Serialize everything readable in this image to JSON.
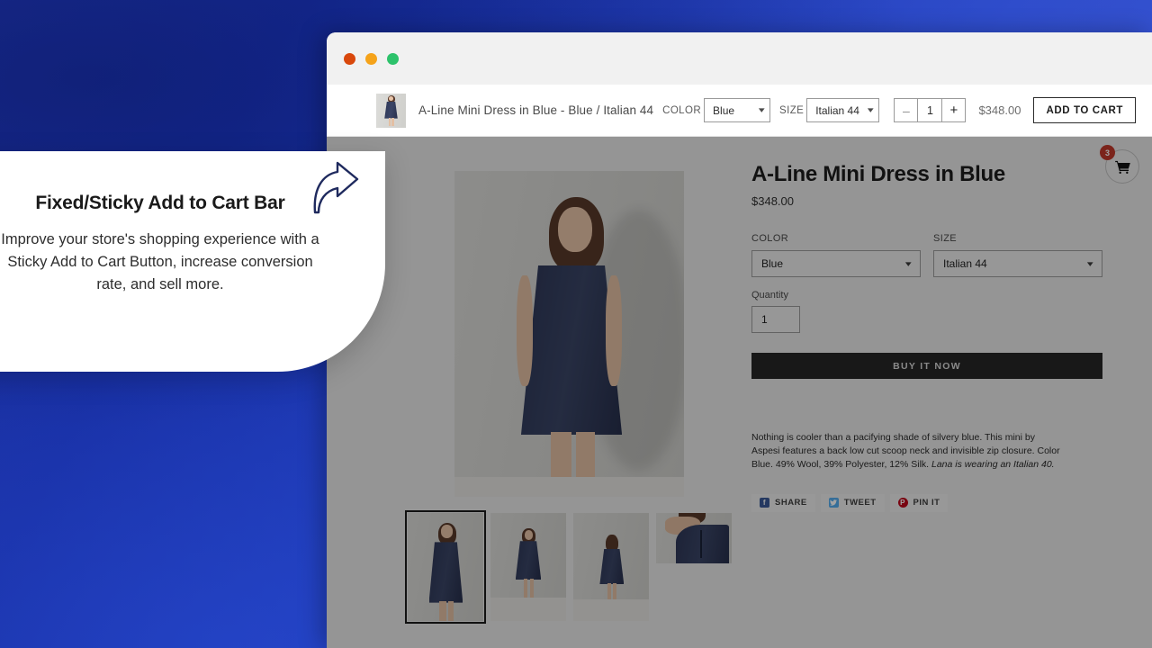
{
  "promo": {
    "title": "Fixed/Sticky Add to Cart Bar",
    "body": "Improve your store's shopping experience with a Sticky Add to Cart Button, increase conversion rate, and sell more.",
    "arrow_icon": "curved-arrow-up-right-icon",
    "arrow_color": "#1f2a5e"
  },
  "browser": {
    "traffic_lights": [
      {
        "name": "close",
        "color": "#d9480c"
      },
      {
        "name": "minimize",
        "color": "#f5a31a"
      },
      {
        "name": "maximize",
        "color": "#2dc26b"
      }
    ]
  },
  "sticky_bar": {
    "thumbnail_icon": "product-thumbnail",
    "product_title": "A-Line Mini Dress in Blue - Blue / Italian 44",
    "color_label": "COLOR",
    "color_value": "Blue",
    "size_label": "SIZE",
    "size_value": "Italian 44",
    "qty_minus": "–",
    "qty_value": "1",
    "qty_plus": "+",
    "price": "$348.00",
    "add_to_cart_label": "ADD TO CART",
    "chevron_icon": "chevron-down-icon"
  },
  "product": {
    "title": "A-Line Mini Dress in Blue",
    "price": "$348.00",
    "color_label": "COLOR",
    "color_value": "Blue",
    "size_label": "SIZE",
    "size_value": "Italian 44",
    "quantity_label": "Quantity",
    "quantity_value": "1",
    "buy_now_label": "BUY IT NOW",
    "description_part1": "Nothing is cooler than a pacifying shade of silvery blue. This mini by Aspesi features a back low cut scoop neck and invisible zip closure. Color Blue. 49% Wool, 39% Polyester, 12% Silk. ",
    "description_emphasis": "Lana is wearing an Italian 40.",
    "share": [
      {
        "icon": "facebook-icon",
        "label": "SHARE",
        "color": "#3b5998",
        "glyph": "f"
      },
      {
        "icon": "twitter-icon",
        "label": "TWEET",
        "color": "#55acee",
        "glyph": "ᵗ"
      },
      {
        "icon": "pinterest-icon",
        "label": "PIN IT",
        "color": "#bd081c",
        "glyph": "P"
      }
    ],
    "gallery": {
      "thumbs": [
        {
          "name": "thumb-front-closeup",
          "selected": true
        },
        {
          "name": "thumb-full-front",
          "selected": false
        },
        {
          "name": "thumb-full-back",
          "selected": false
        },
        {
          "name": "thumb-back-zipper-detail",
          "selected": false
        }
      ]
    }
  },
  "cart": {
    "icon": "shopping-cart-icon",
    "badge_count": "3",
    "badge_color": "#c0392b"
  }
}
